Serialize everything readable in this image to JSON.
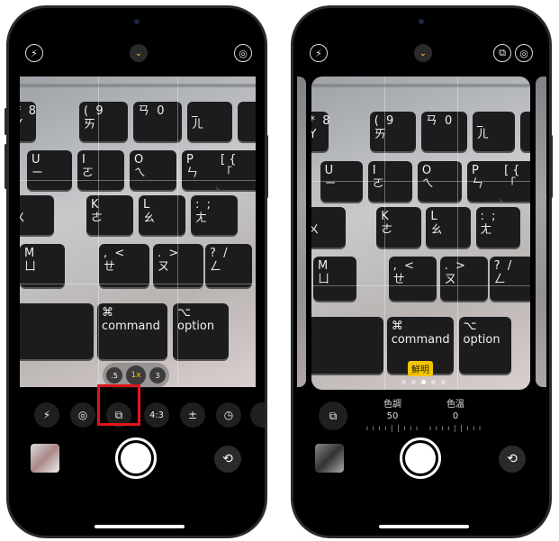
{
  "keyboard": [
    {
      "l": "*  8\nY"
    },
    {
      "l": "(  9\nㄞ"
    },
    {
      "l": "ㄢ  0\n"
    },
    {
      "l": "_\nㄦ"
    },
    {
      "l": ""
    },
    {
      "l": "U\nㄧ"
    },
    {
      "l": "I\nㄛ"
    },
    {
      "l": "O\nㄟ"
    },
    {
      "l": "P\nㄣ"
    },
    {
      "l": "[ {\n「 "
    },
    {
      "l": "J\nㄨ"
    },
    {
      "l": "K\nㄜ"
    },
    {
      "l": "L\nㄠ"
    },
    {
      "l": ":  ;\nㄤ"
    },
    {
      "l": "M\nㄩ"
    },
    {
      "l": ",  <\nㄝ"
    },
    {
      "l": ".  >\nㄡ"
    },
    {
      "l": "?  /\nㄥ"
    },
    {
      "l": ""
    },
    {
      "l": "⌘\ncommand"
    },
    {
      "l": "⌥\noption"
    }
  ],
  "left": {
    "top": {
      "flash": "⚡",
      "live": "◎",
      "expand": "⌄"
    },
    "zoom": [
      ".5",
      "1x",
      "3"
    ],
    "controls": [
      "⚡",
      "◎",
      "⧉",
      "4:3",
      "±",
      "◷"
    ],
    "flip": "⟲"
  },
  "right": {
    "top": {
      "flash": "⚡",
      "styles": "⧉",
      "live": "◎",
      "expand": "⌄"
    },
    "style_badge": "鮮明",
    "page_dots": 5,
    "active_dot": 2,
    "styles_icon": "⧉",
    "tone": {
      "label": "色調",
      "value": "50"
    },
    "warmth": {
      "label": "色溫",
      "value": "0"
    },
    "ticks": "ı ı ı ı | | ı ı ı",
    "flip": "⟲"
  },
  "colors": {
    "accent": "#f5c400",
    "highlight": "#e0161b"
  }
}
